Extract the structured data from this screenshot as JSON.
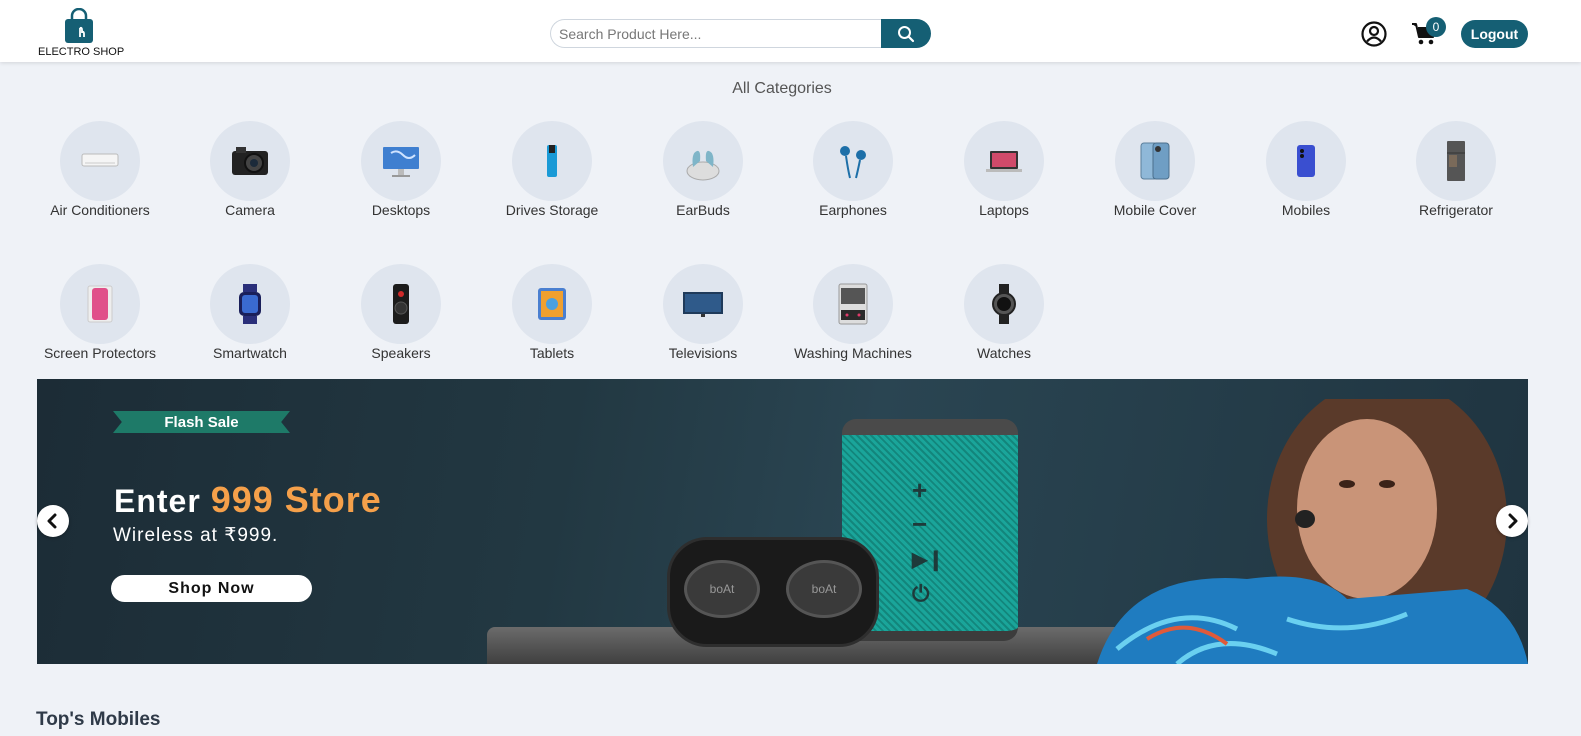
{
  "header": {
    "logo_text": "ELECTRO SHOP",
    "search_placeholder": "Search Product Here...",
    "cart_count": "0",
    "logout_label": "Logout"
  },
  "categories": {
    "title": "All Categories",
    "items": [
      {
        "label": "Air Conditioners",
        "icon": "air-conditioner-icon"
      },
      {
        "label": "Camera",
        "icon": "camera-icon"
      },
      {
        "label": "Desktops",
        "icon": "desktop-icon"
      },
      {
        "label": "Drives Storage",
        "icon": "drive-storage-icon"
      },
      {
        "label": "EarBuds",
        "icon": "earbuds-icon"
      },
      {
        "label": "Earphones",
        "icon": "earphones-icon"
      },
      {
        "label": "Laptops",
        "icon": "laptop-icon"
      },
      {
        "label": "Mobile Cover",
        "icon": "mobile-cover-icon"
      },
      {
        "label": "Mobiles",
        "icon": "mobile-icon"
      },
      {
        "label": "Refrigerator",
        "icon": "refrigerator-icon"
      },
      {
        "label": "Screen Protectors",
        "icon": "screen-protector-icon"
      },
      {
        "label": "Smartwatch",
        "icon": "smartwatch-icon"
      },
      {
        "label": "Speakers",
        "icon": "speaker-icon"
      },
      {
        "label": "Tablets",
        "icon": "tablet-icon"
      },
      {
        "label": "Televisions",
        "icon": "television-icon"
      },
      {
        "label": "Washing Machines",
        "icon": "washing-machine-icon"
      },
      {
        "label": "Watches",
        "icon": "watch-icon"
      }
    ]
  },
  "banner": {
    "badge": "Flash Sale",
    "headline_prefix": "Enter",
    "headline_highlight": "999 Store",
    "subline": "Wireless at ₹999.",
    "cta": "Shop Now",
    "bud_brand": "boAt"
  },
  "section": {
    "title": "Top's Mobiles"
  },
  "colors": {
    "primary": "#155f74",
    "background": "#eff2f7",
    "highlight": "#f5a04a"
  }
}
